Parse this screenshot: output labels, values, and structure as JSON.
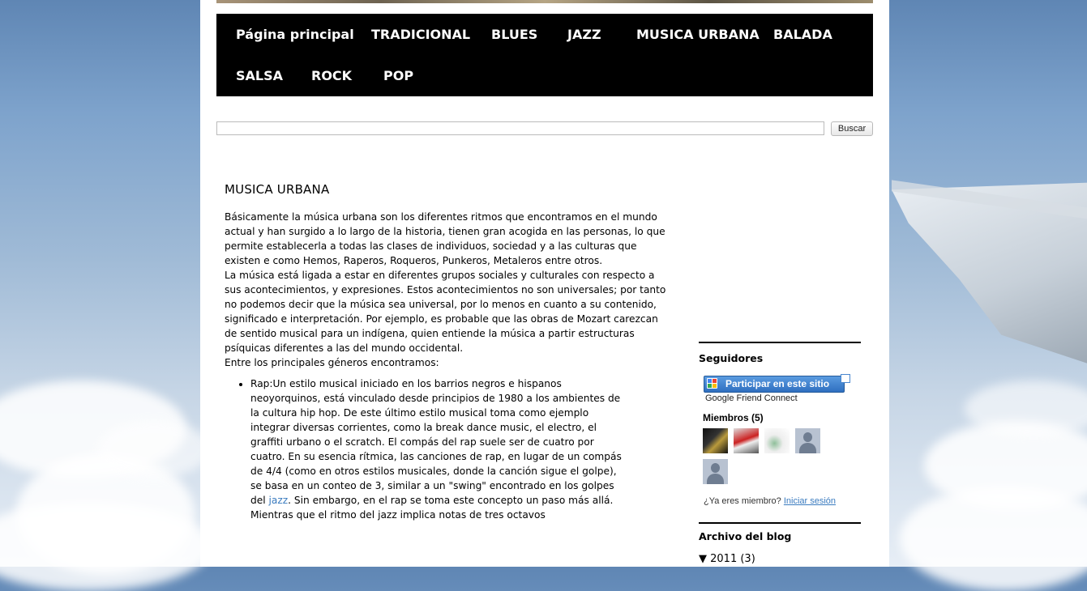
{
  "nav": {
    "items": [
      "Página principal",
      "TRADICIONAL",
      "BLUES",
      "JAZZ",
      "MUSICA URBANA",
      "BALADA",
      "SALSA",
      "ROCK",
      "POP"
    ]
  },
  "search": {
    "value": "",
    "button_label": "Buscar"
  },
  "post": {
    "title": "MUSICA URBANA",
    "paragraphs": [
      "Básicamente la música urbana son los diferentes ritmos que encontramos en el mundo actual y han surgido a lo largo de la historia, tienen gran acogida en las personas, lo que permite establecerla a todas las clases de individuos, sociedad y a las culturas que existen e como Hemos, Raperos, Roqueros, Punkeros, Metaleros entre otros.",
      "La música está ligada a estar en diferentes grupos sociales y culturales con respecto a sus acontecimientos, y expresiones. Estos acontecimientos no son universales; por tanto no podemos decir que la música sea universal, por lo menos en cuanto a su contenido, significado e interpretación. Por ejemplo, es probable que las obras de Mozart carezcan de sentido musical para un indígena, quien entiende la música a partir estructuras psíquicas diferentes a las del mundo occidental.",
      "Entre los principales géneros encontramos:"
    ],
    "rap": {
      "before": "Rap:Un estilo musical iniciado en los barrios negros e hispanos neoyorquinos, está vinculado desde principios de 1980 a los ambientes de la cultura hip hop. De este último estilo musical toma como ejemplo integrar diversas corrientes, como la break dance music, el electro, el graffiti urbano o el scratch. El compás del rap suele ser de cuatro por cuatro. En su esencia rítmica, las canciones de rap, en lugar de un compás de 4/4 (como en otros estilos musicales, donde la canción sigue el golpe), se basa en un conteo de 3, similar a un \"swing\" encontrado en los golpes del ",
      "link": "jazz",
      "after": ". Sin embargo, en el rap se toma este concepto un paso más allá. Mientras que el ritmo del jazz implica notas de tres octavos"
    }
  },
  "sidebar": {
    "followers_title": "Seguidores",
    "gfc_button": "Participar en este sitio",
    "gfc_sub": "Google Friend Connect",
    "members_title": "Miembros (5)",
    "member_prompt": "¿Ya eres miembro?",
    "sign_in_link": "Iniciar sesión",
    "archive_title": "Archivo del blog",
    "archive_year": "▼  2011 (3)"
  },
  "colors": {
    "nav_bg": "#000000",
    "nav_text": "#ffffff",
    "link": "#3a7bbf",
    "gfc_button": "#3f84d4"
  }
}
